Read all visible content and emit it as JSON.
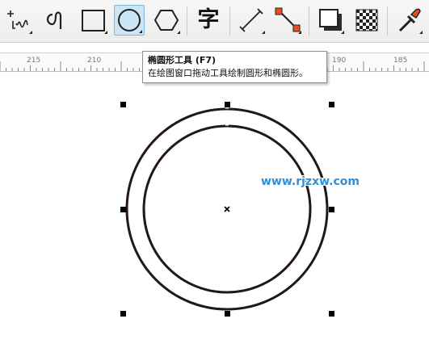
{
  "toolbar": {
    "tools": [
      {
        "name": "freehand-tool",
        "active": false
      },
      {
        "name": "bezier-tool",
        "active": false
      },
      {
        "name": "rectangle-tool",
        "active": false
      },
      {
        "name": "ellipse-tool",
        "active": true
      },
      {
        "name": "polygon-tool",
        "active": false
      },
      {
        "name": "text-tool",
        "active": false
      },
      {
        "name": "dimension-tool",
        "active": false
      },
      {
        "name": "connector-tool",
        "active": false
      },
      {
        "name": "drop-shadow-tool",
        "active": false
      },
      {
        "name": "transparency-tool",
        "active": false
      },
      {
        "name": "eyedropper-tool",
        "active": false
      }
    ],
    "text_tool_glyph": "字"
  },
  "ruler": {
    "labels": [
      "215",
      "210",
      "190",
      "185"
    ],
    "accent_color": "#41a3e0"
  },
  "tooltip": {
    "title": "椭圆形工具 (F7)",
    "description": "在绘图窗口拖动工具绘制圆形和椭圆形。"
  },
  "watermark": "www.rjzxw.com",
  "colors": {
    "active_tool_bg": "#cde6f7",
    "circle_stroke": "#231815",
    "handle": "#000000",
    "watermark": "#2f8fd9"
  }
}
